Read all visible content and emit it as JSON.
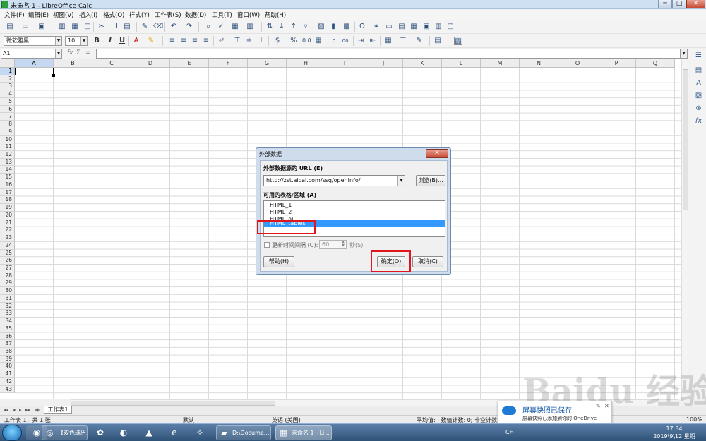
{
  "window": {
    "title": "未命名 1 - LibreOffice Calc",
    "min": "─",
    "max": "□",
    "close": "✕"
  },
  "menu": [
    "文件(F)",
    "编辑(E)",
    "视图(V)",
    "插入(I)",
    "格式(O)",
    "样式(Y)",
    "工作表(S)",
    "数据(D)",
    "工具(T)",
    "窗口(W)",
    "帮助(H)"
  ],
  "formatting": {
    "font_name": "微软雅黑",
    "font_size": "10"
  },
  "formula": {
    "name_box": "A1",
    "fx": "fx",
    "sigma": "Σ",
    "equals": "="
  },
  "sheet": {
    "columns": [
      "A",
      "B",
      "C",
      "D",
      "E",
      "F",
      "G",
      "H",
      "I",
      "J",
      "K",
      "L",
      "M",
      "N",
      "O",
      "P",
      "Q"
    ],
    "rows": [
      "1",
      "2",
      "3",
      "4",
      "5",
      "6",
      "7",
      "8",
      "9",
      "10",
      "11",
      "12",
      "13",
      "14",
      "15",
      "16",
      "17",
      "18",
      "19",
      "20",
      "21",
      "22",
      "23",
      "24",
      "25",
      "26",
      "27",
      "28",
      "29",
      "30",
      "31",
      "32",
      "33",
      "34",
      "35",
      "36",
      "37",
      "38",
      "39",
      "40",
      "41",
      "42",
      "43"
    ],
    "selected_col": "A",
    "selected_row": "1"
  },
  "tabs": {
    "nav": [
      "◂◂",
      "◂",
      "▸",
      "▸▸"
    ],
    "add": "+",
    "active": "工作表1"
  },
  "status": {
    "sheet_info": "工作表 1，共 1 张",
    "style": "默认",
    "language": "英语 (美国)",
    "stats": "平均值: ; 数值计数: 0; 非空计数: 0",
    "zoom": "100%"
  },
  "dialog": {
    "title": "外部数据",
    "close": "✕",
    "url_label": "外部数据源的 URL (E)",
    "url_value": "http://zst.aicai.com/ssq/openInfo/",
    "browse": "浏览(B)...",
    "tables_label": "可用的表格/区域 (A)",
    "tables": [
      "HTML_1",
      "HTML_2",
      "HTML_all",
      "HTML_tables"
    ],
    "selected_table": "HTML_tables",
    "update_label": "更新时间间隔 (U):",
    "interval": "60",
    "interval_unit": "秒(S)",
    "help": "帮助(H)",
    "ok": "确定(O)",
    "cancel": "取消(C)"
  },
  "taskbar": {
    "buttons": [
      "【双色球历...",
      "D:\\Docume...",
      "未命名 1 - Li..."
    ],
    "time": "17:34",
    "date": "2019\\9\\12 星期四",
    "tray_lang": "CH"
  },
  "toast": {
    "title": "屏幕快照已保存",
    "body": "屏幕快照已添加到你的 OneDrive",
    "close": "✕",
    "pin": "✎"
  },
  "watermark": "Baidu 经验",
  "colors": {
    "accent": "#3399ff",
    "highlight": "#e0161d",
    "selection_header": "#c4d9f1"
  }
}
